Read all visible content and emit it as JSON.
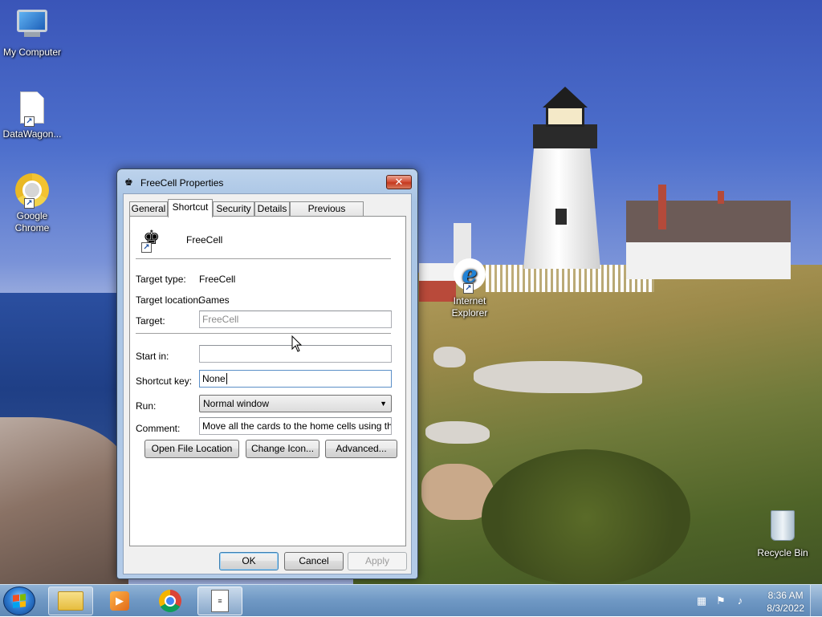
{
  "desktop": {
    "icons": [
      {
        "label": "My Computer",
        "icon": "computer-icon"
      },
      {
        "label": "DataWagon...",
        "icon": "document-icon"
      },
      {
        "label": "Google Chrome",
        "icon": "chrome-icon"
      },
      {
        "label": "Internet Explorer",
        "icon": "internet-explorer-icon"
      },
      {
        "label": "Recycle Bin",
        "icon": "recycle-bin-icon"
      }
    ]
  },
  "dialog": {
    "title": "FreeCell Properties",
    "close_glyph": "✕",
    "tabs": [
      {
        "label": "General",
        "active": false
      },
      {
        "label": "Shortcut",
        "active": true
      },
      {
        "label": "Security",
        "active": false
      },
      {
        "label": "Details",
        "active": false
      },
      {
        "label": "Previous Versions",
        "active": false
      }
    ],
    "app_name": "FreeCell",
    "fields": {
      "target_type_label": "Target type:",
      "target_type_value": "FreeCell",
      "target_location_label": "Target location:",
      "target_location_value": "Games",
      "target_label": "Target:",
      "target_value": "FreeCell",
      "start_in_label": "Start in:",
      "start_in_value": "",
      "shortcut_key_label": "Shortcut key:",
      "shortcut_key_value": "None",
      "run_label": "Run:",
      "run_value": "Normal window",
      "comment_label": "Comment:",
      "comment_value": "Move all the cards to the home cells using the free"
    },
    "buttons": {
      "open_file_location": "Open File Location",
      "change_icon": "Change Icon...",
      "advanced": "Advanced...",
      "ok": "OK",
      "cancel": "Cancel",
      "apply": "Apply"
    }
  },
  "taskbar": {
    "items": [
      "file-explorer-icon",
      "media-player-icon",
      "chrome-icon",
      "document-icon"
    ],
    "tray": {
      "time": "8:36 AM",
      "date": "8/3/2022"
    }
  },
  "colors": {
    "accent": "#3c7fb1",
    "close_button": "#c5391f",
    "taskbar": "#6f98c4"
  }
}
